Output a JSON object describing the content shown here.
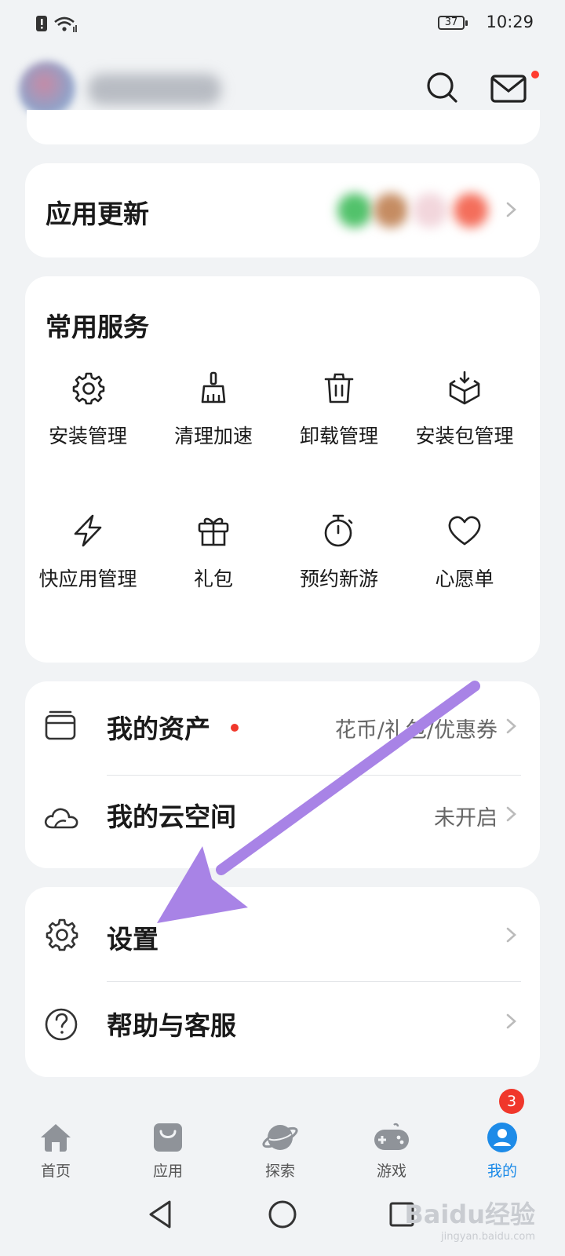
{
  "status_bar": {
    "time": "10:29",
    "battery": "37"
  },
  "app_update": {
    "title": "应用更新"
  },
  "services": {
    "title": "常用服务",
    "items": [
      {
        "label": "安装管理",
        "icon": "gear-icon"
      },
      {
        "label": "清理加速",
        "icon": "broom-icon"
      },
      {
        "label": "卸载管理",
        "icon": "trash-icon"
      },
      {
        "label": "安装包管理",
        "icon": "package-icon"
      },
      {
        "label": "快应用管理",
        "icon": "lightning-icon"
      },
      {
        "label": "礼包",
        "icon": "gift-icon"
      },
      {
        "label": "预约新游",
        "icon": "stopwatch-icon"
      },
      {
        "label": "心愿单",
        "icon": "heart-icon"
      }
    ]
  },
  "assets": {
    "my_assets": {
      "label": "我的资产",
      "value": "花币/礼包/优惠券"
    },
    "cloud_space": {
      "label": "我的云空间",
      "value": "未开启"
    }
  },
  "settings_group": {
    "settings": {
      "label": "设置"
    },
    "help": {
      "label": "帮助与客服"
    }
  },
  "bottom_nav": {
    "items": [
      {
        "label": "首页",
        "icon": "home-icon"
      },
      {
        "label": "应用",
        "icon": "bag-icon"
      },
      {
        "label": "探索",
        "icon": "planet-icon"
      },
      {
        "label": "游戏",
        "icon": "gamepad-icon"
      },
      {
        "label": "我的",
        "icon": "user-icon",
        "active": true,
        "badge": "3"
      }
    ]
  },
  "watermark": {
    "brand": "Baidu经验",
    "url": "jingyan.baidu.com"
  },
  "colors": {
    "accent": "#1d8be8",
    "badge": "#f0372b",
    "arrow": "#a883e6"
  }
}
